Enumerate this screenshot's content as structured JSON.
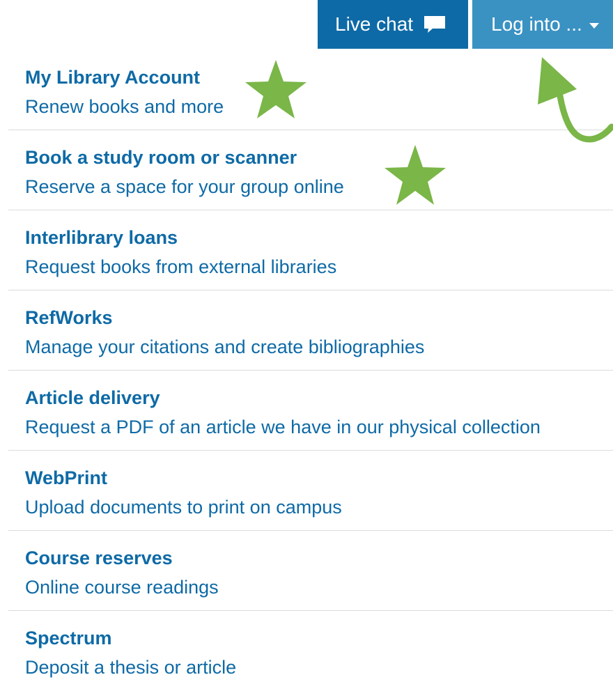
{
  "header": {
    "live_chat_label": "Live chat",
    "live_chat_icon": "speech-bubble-icon",
    "login_label": "Log into ...",
    "login_icon": "caret-down-icon",
    "colors": {
      "primary_blue": "#0e6aa6",
      "secondary_blue": "#3a92c3",
      "annotation_green": "#7ab648"
    }
  },
  "menu": {
    "items": [
      {
        "title": "My Library Account",
        "description": "Renew books and more"
      },
      {
        "title": "Book a study room or scanner",
        "description": "Reserve a space for your group online"
      },
      {
        "title": "Interlibrary loans",
        "description": "Request books from external libraries"
      },
      {
        "title": "RefWorks",
        "description": "Manage your citations and create bibliographies"
      },
      {
        "title": "Article delivery",
        "description": "Request a PDF of an article we have in our physical collection"
      },
      {
        "title": "WebPrint",
        "description": "Upload documents to print on campus"
      },
      {
        "title": "Course reserves",
        "description": "Online course readings"
      },
      {
        "title": "Spectrum",
        "description": "Deposit a thesis or article"
      }
    ]
  },
  "annotations": {
    "star_icon": "star-icon",
    "arrow_icon": "curved-arrow-icon"
  }
}
